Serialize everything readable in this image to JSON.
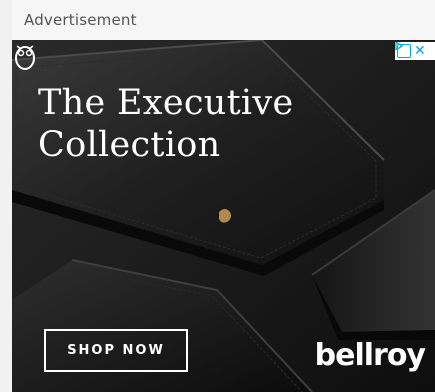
{
  "header": {
    "label": "Advertisement"
  },
  "ad": {
    "headline": "The Executive\nCollection",
    "cta_label": "SHOP NOW",
    "brand": "bellroy",
    "icons": [
      "adchoices-icon",
      "close-icon",
      "owl-logo-icon"
    ],
    "colors": {
      "background": "#1b1b1b",
      "text": "#ffffff",
      "adchoices": "#00a9e0"
    }
  }
}
